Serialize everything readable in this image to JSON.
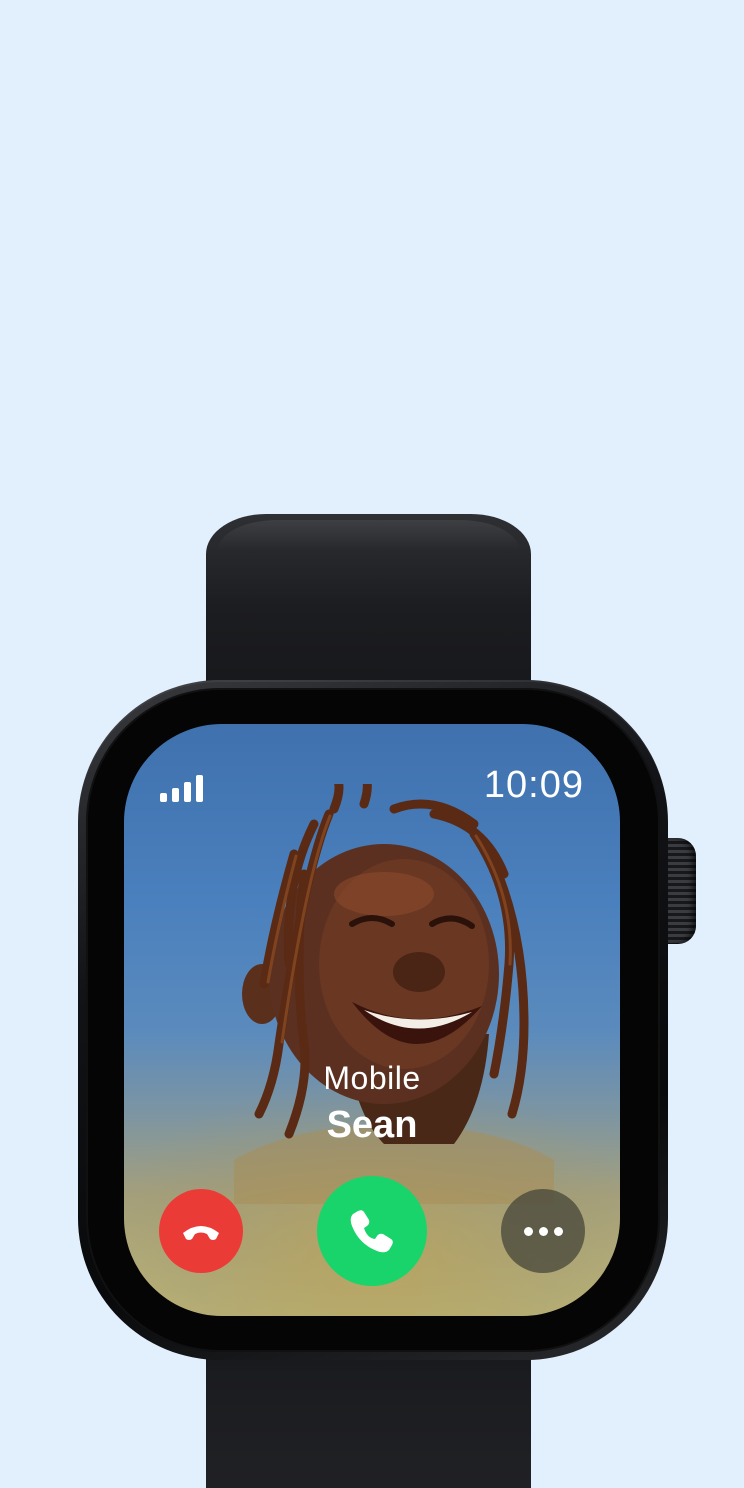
{
  "status_bar": {
    "signal_bars": 4,
    "time": "10:09"
  },
  "call": {
    "caller_type": "Mobile",
    "caller_name": "Sean"
  },
  "actions": [
    {
      "name": "decline",
      "icon": "phone-down-icon",
      "color": "#eb3b37"
    },
    {
      "name": "accept",
      "icon": "phone-icon",
      "color": "#19d46a"
    },
    {
      "name": "more",
      "icon": "ellipsis-icon",
      "color": "#46463a"
    }
  ],
  "colors": {
    "page_background": "#e2effd",
    "watch_case": "#0a0b0d",
    "text": "#ffffff"
  }
}
